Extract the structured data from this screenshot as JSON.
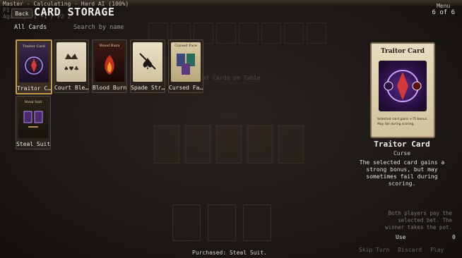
{
  "status": {
    "line1": "Master - Calculating - Hard AI (100%)",
    "line2": "P1 ...  ",
    "line3": "Agility P1 +1 / P2 2"
  },
  "header": {
    "back_label": "Back",
    "title": "CARD STORAGE",
    "menu_label": "Menu",
    "page_indicator": "6 of 6"
  },
  "filters": {
    "category": "All Cards",
    "search_placeholder": "Search by name"
  },
  "cards": [
    {
      "name": "Traitor C…",
      "mini": "Traitor Card",
      "selected": true
    },
    {
      "name": "Court Ble…",
      "mini": "",
      "selected": false
    },
    {
      "name": "Blood Burn",
      "mini": "Blood Burn",
      "selected": false
    },
    {
      "name": "Spade Str…",
      "mini": "",
      "selected": false
    },
    {
      "name": "Cursed Fa…",
      "mini": "Cursed Face",
      "selected": false
    },
    {
      "name": "Steal Suit",
      "mini": "Steal Suit",
      "selected": false
    }
  ],
  "detail": {
    "art_title": "Traitor Card",
    "art_desc_1": "Selected card gains +75 bonus.",
    "art_desc_2": "May fail during scoring.",
    "name": "Traitor Card",
    "type": "Curse",
    "description": "The selected card gains a strong bonus, but may sometimes fail during scoring."
  },
  "table": {
    "opponent_label": "Opponent Cards on Table",
    "info": "Both players pay the selected bet. The winner takes the pot.",
    "use_label": "Use",
    "use_value": "0"
  },
  "bottom": {
    "skip_turn": "Skip Turn",
    "discard": "Discard",
    "play": "Play",
    "message": "Purchased: Steal Suit."
  }
}
